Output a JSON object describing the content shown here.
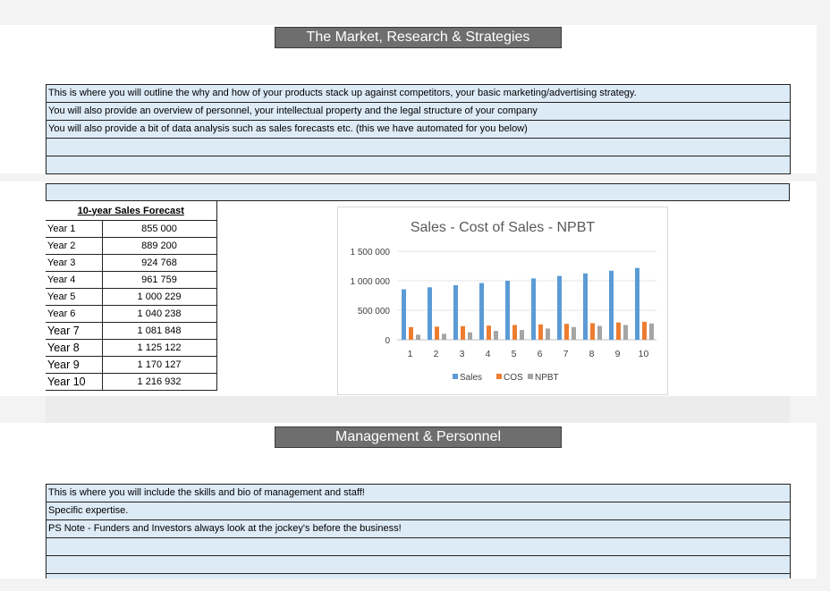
{
  "section1": {
    "title": "The Market, Research & Strategies",
    "rows": [
      "This is where you will outline the why and how of your products stack up against competitors, your basic marketing/advertising strategy.",
      "You will also provide an overview of personnel, your intellectual property and the legal structure of your company",
      "You will also provide a bit of data analysis such as sales forecasts etc. (this we have automated for you below)",
      "",
      ""
    ]
  },
  "forecast": {
    "header": "10-year Sales Forecast",
    "rows": [
      {
        "year": "Year 1",
        "value": "855 000"
      },
      {
        "year": "Year 2",
        "value": "889 200"
      },
      {
        "year": "Year 3",
        "value": "924 768"
      },
      {
        "year": "Year 4",
        "value": "961 759"
      },
      {
        "year": "Year 5",
        "value": "1 000 229"
      },
      {
        "year": "Year 6",
        "value": "1 040 238"
      },
      {
        "year": "Year 7",
        "value": "1 081 848"
      },
      {
        "year": "Year 8",
        "value": "1 125 122"
      },
      {
        "year": "Year 9",
        "value": "1 170 127"
      },
      {
        "year": "Year 10",
        "value": "1 216 932"
      }
    ]
  },
  "chart_data": {
    "type": "bar",
    "title": "Sales - Cost of Sales - NPBT",
    "categories": [
      "1",
      "2",
      "3",
      "4",
      "5",
      "6",
      "7",
      "8",
      "9",
      "10"
    ],
    "series": [
      {
        "name": "Sales",
        "color": "#5b9bd5",
        "values": [
          855000,
          889200,
          924768,
          961759,
          1000229,
          1040238,
          1081848,
          1125122,
          1170127,
          1216932
        ]
      },
      {
        "name": "COS",
        "color": "#ed7d31",
        "values": [
          214000,
          222000,
          231000,
          240000,
          250000,
          260000,
          270000,
          281000,
          292000,
          304000
        ]
      },
      {
        "name": "NPBT",
        "color": "#a5a5a5",
        "values": [
          85000,
          100000,
          125000,
          150000,
          165000,
          190000,
          215000,
          235000,
          250000,
          275000
        ]
      }
    ],
    "ylim": [
      0,
      1500000
    ],
    "yticks": [
      "0",
      "500 000",
      "1 000 000",
      "1 500 000"
    ],
    "ytick_values": [
      0,
      500000,
      1000000,
      1500000
    ],
    "legend": "bottom",
    "grid": true
  },
  "section2": {
    "title": "Management & Personnel",
    "rows": [
      "This is where you will include the skills and bio of management and staff!",
      "Specific expertise.",
      "PS Note - Funders and Investors always look at the jockey's before the business!",
      "",
      ""
    ]
  }
}
